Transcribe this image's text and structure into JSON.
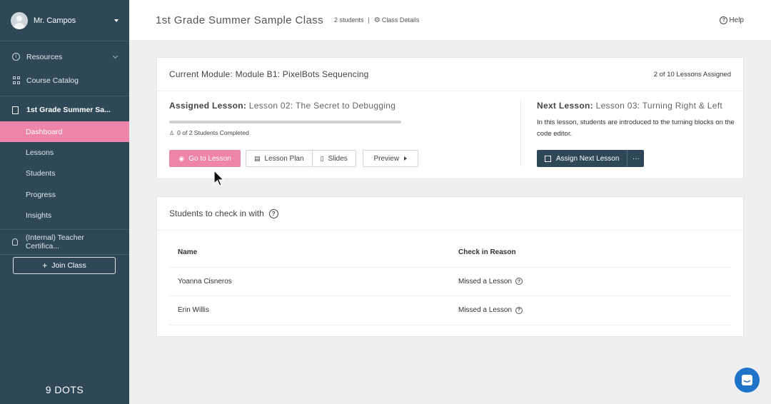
{
  "sidebar": {
    "user_name": "Mr. Campos",
    "nav": [
      {
        "label": "Resources",
        "icon": "info-icon"
      },
      {
        "label": "Course Catalog",
        "icon": "grid-icon"
      }
    ],
    "class_title": "1st Grade Summer Sa...",
    "class_items": [
      {
        "label": "Dashboard",
        "active": true
      },
      {
        "label": "Lessons",
        "active": false
      },
      {
        "label": "Students",
        "active": false
      },
      {
        "label": "Progress",
        "active": false
      },
      {
        "label": "Insights",
        "active": false
      }
    ],
    "certification": "(Internal) Teacher Certifica...",
    "join_class": "Join Class",
    "brand": "9 DOTS"
  },
  "header": {
    "class_name": "1st Grade Summer Sample Class",
    "student_count": "2 students",
    "separator": "|",
    "class_details": "Class Details",
    "help": "Help"
  },
  "module": {
    "title": "Current Module: Module B1: PixelBots Sequencing",
    "assigned_count": "2 of 10 Lessons Assigned",
    "assigned_label": "Assigned Lesson:",
    "assigned_lesson": "Lesson 02: The Secret to Debugging",
    "progress_fraction": 0,
    "completed_text": "0 of 2 Students Completed",
    "buttons": {
      "go_to_lesson": "Go to Lesson",
      "lesson_plan": "Lesson Plan",
      "slides": "Slides",
      "preview": "Preview"
    },
    "next_label": "Next Lesson:",
    "next_lesson": "Lesson 03: Turning Right & Left",
    "next_description": "In this lesson, students are introduced to the turning blocks on the code editor.",
    "assign_next": "Assign Next Lesson",
    "more": "···"
  },
  "students": {
    "title": "Students to check in with",
    "columns": [
      "Name",
      "Check in Reason"
    ],
    "rows": [
      {
        "name": "Yoanna Cisneros",
        "reason": "Missed a Lesson"
      },
      {
        "name": "Erin Willis",
        "reason": "Missed a Lesson"
      }
    ]
  },
  "colors": {
    "sidebar_bg": "#2f4858",
    "active_pink": "#ee84a9",
    "chat_blue": "#1f73c9"
  }
}
